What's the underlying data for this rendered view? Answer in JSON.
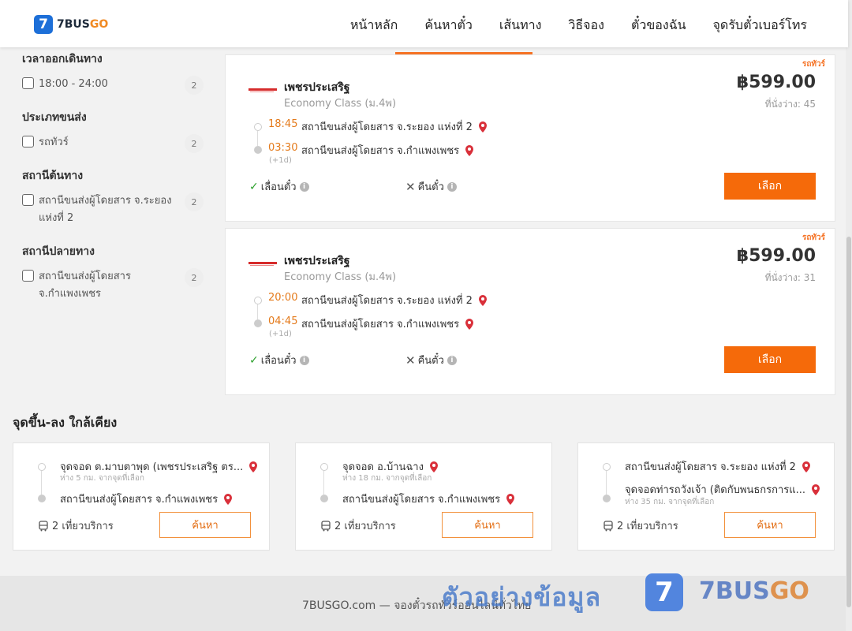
{
  "header": {
    "logo_digit": "7",
    "logo_text": "7BUS",
    "logo_text_accent": "GO",
    "nav": [
      "หน้าหลัก",
      "ค้นหาตั๋ว",
      "เส้นทาง",
      "วิธีจอง",
      "ตั๋วของฉัน",
      "จุดรับตั๋วเบอร์โทร"
    ]
  },
  "filters": {
    "departure_time": {
      "title": "เวลาออกเดินทาง",
      "options": [
        {
          "label": "18:00 - 24:00",
          "count": "2"
        }
      ]
    },
    "transport_type": {
      "title": "ประเภทขนส่ง",
      "options": [
        {
          "label": "รถทัวร์",
          "count": "2"
        }
      ]
    },
    "origin_station": {
      "title": "สถานีต้นทาง",
      "options": [
        {
          "label": "สถานีขนส่งผู้โดยสาร จ.ระยอง แห่งที่ 2",
          "count": "2"
        }
      ]
    },
    "destination_station": {
      "title": "สถานีปลายทาง",
      "options": [
        {
          "label": "สถานีขนส่งผู้โดยสาร จ.กำแพงเพชร",
          "count": "2"
        }
      ]
    }
  },
  "trips": [
    {
      "tag": "รถทัวร์",
      "operator": "เพชรประเสริฐ",
      "class": "Economy Class (ม.4พ)",
      "price": "฿599.00",
      "seats": "ที่นั่งว่าง: 45",
      "dep_time": "18:45",
      "dep_station": "สถานีขนส่งผู้โดยสาร จ.ระยอง แห่งที่ 2",
      "arr_time": "03:30",
      "arr_station": "สถานีขนส่งผู้โดยสาร จ.กำแพงเพชร",
      "next_day": "(+1d)",
      "change": "เลื่อนตั๋ว",
      "refund": "คืนตั๋ว",
      "select": "เลือก"
    },
    {
      "tag": "รถทัวร์",
      "operator": "เพชรประเสริฐ",
      "class": "Economy Class (ม.4พ)",
      "price": "฿599.00",
      "seats": "ที่นั่งว่าง: 31",
      "dep_time": "20:00",
      "dep_station": "สถานีขนส่งผู้โดยสาร จ.ระยอง แห่งที่ 2",
      "arr_time": "04:45",
      "arr_station": "สถานีขนส่งผู้โดยสาร จ.กำแพงเพชร",
      "next_day": "(+1d)",
      "change": "เลื่อนตั๋ว",
      "refund": "คืนตั๋ว",
      "select": "เลือก"
    }
  ],
  "nearby": {
    "title": "จุดขึ้น-ลง ใกล้เคียง",
    "cards": [
      {
        "from": "จุดจอด ต.มาบตาพุด (เพชรประเสริฐ ตร...",
        "from_dist": "ห่าง 5 กม. จากจุดที่เลือก",
        "to": "สถานีขนส่งผู้โดยสาร จ.กำแพงเพชร",
        "to_dist": "",
        "trips": "2 เที่ยวบริการ",
        "search": "ค้นหา"
      },
      {
        "from": "จุดจอด อ.บ้านฉาง",
        "from_dist": "ห่าง 18 กม. จากจุดที่เลือก",
        "to": "สถานีขนส่งผู้โดยสาร จ.กำแพงเพชร",
        "to_dist": "",
        "trips": "2 เที่ยวบริการ",
        "search": "ค้นหา"
      },
      {
        "from": "สถานีขนส่งผู้โดยสาร จ.ระยอง แห่งที่ 2",
        "from_dist": "",
        "to": "จุดจอดท่ารถวังเจ้า (ติดกับพนธกรการแ...",
        "to_dist": "ห่าง 35 กม. จากจุดที่เลือก",
        "trips": "2 เที่ยวบริการ",
        "search": "ค้นหา"
      }
    ]
  },
  "footer": {
    "text": "7BUSGO.com — จองตั๋วรถทัวร์ออนไลน์ทั่วไทย",
    "watermark": "ตัวอย่างข้อมูล",
    "watermark_digit": "7",
    "watermark_brand": "7BUS",
    "watermark_brand_accent": "GO"
  },
  "colors": {
    "accent": "#f56a0a",
    "brand_blue": "#1d6fd8",
    "time": "#e47a1b",
    "check": "#2ca02c",
    "pin": "#d9303a"
  }
}
